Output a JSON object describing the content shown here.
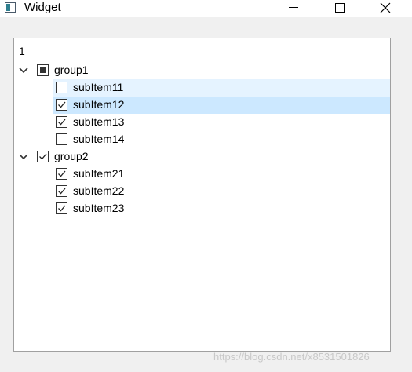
{
  "window": {
    "title": "Widget",
    "icon": "app-window-icon",
    "controls": [
      "minimize-icon",
      "maximize-icon",
      "close-icon"
    ]
  },
  "tree": {
    "header": "1",
    "groups": [
      {
        "label": "group1",
        "expanded": true,
        "check_state": "partial",
        "children": [
          {
            "label": "subItem11",
            "checked": false,
            "state": "hover"
          },
          {
            "label": "subItem12",
            "checked": true,
            "state": "selected"
          },
          {
            "label": "subItem13",
            "checked": true
          },
          {
            "label": "subItem14",
            "checked": false
          }
        ]
      },
      {
        "label": "group2",
        "expanded": true,
        "check_state": "checked",
        "children": [
          {
            "label": "subItem21",
            "checked": true
          },
          {
            "label": "subItem22",
            "checked": true
          },
          {
            "label": "subItem23",
            "checked": true
          }
        ]
      }
    ]
  },
  "watermark": "https://blog.csdn.net/x8531501826",
  "colors": {
    "selected_bg": "#cce8ff",
    "hover_bg": "#e5f3ff"
  }
}
